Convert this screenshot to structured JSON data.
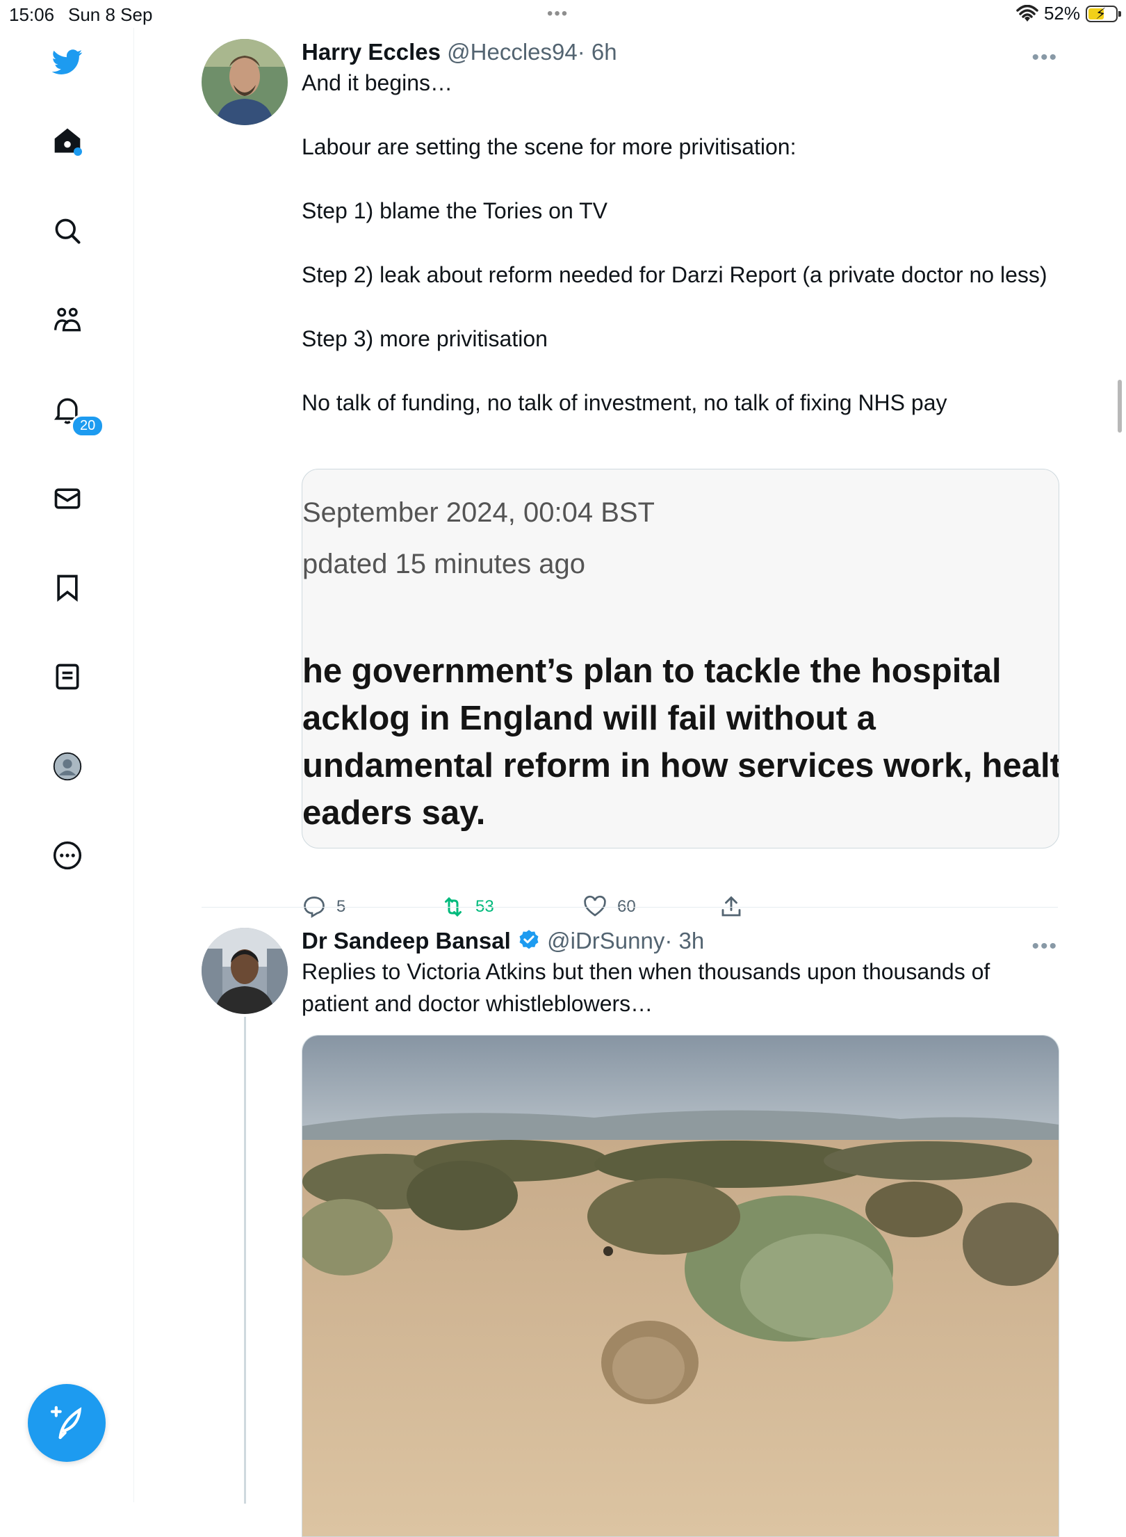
{
  "status_bar": {
    "time": "15:06",
    "date": "Sun 8 Sep",
    "battery": "52%"
  },
  "sidebar": {
    "items": [
      {
        "icon": "twitter-bird-icon"
      },
      {
        "icon": "home-icon"
      },
      {
        "icon": "search-icon"
      },
      {
        "icon": "communities-icon"
      },
      {
        "icon": "notifications-icon",
        "badge": "20"
      },
      {
        "icon": "messages-icon"
      },
      {
        "icon": "bookmark-icon"
      },
      {
        "icon": "lists-icon"
      },
      {
        "icon": "profile-icon"
      },
      {
        "icon": "more-icon"
      }
    ],
    "compose_icon": "compose-icon"
  },
  "tweets": [
    {
      "name": "Harry Eccles",
      "handle": "@Heccles94",
      "time": "· 6h",
      "text": [
        "And it begins…",
        "Labour are setting the scene for more privitisation:",
        "Step 1) blame the Tories on TV",
        "Step 2) leak about reform needed for Darzi Report (a private doctor no less)",
        "Step 3) more privitisation",
        "No talk of funding, no talk of investment, no talk of fixing NHS pay"
      ],
      "card": {
        "line1": "September 2024, 00:04 BST",
        "line2": "pdated 15 minutes ago",
        "headline": [
          "he government’s plan to tackle the hospital",
          "acklog in England will fail without a",
          "undamental reform in how services work, health",
          "eaders say."
        ]
      },
      "actions": {
        "replies": "5",
        "retweets": "53",
        "likes": "60"
      },
      "colors": {
        "retweet": "#00ba7c"
      }
    },
    {
      "name": "Dr Sandeep Bansal",
      "handle": "@iDrSunny",
      "time": "· 3h",
      "verified": true,
      "text": [
        "Replies to Victoria Atkins but then when thousands upon thousands of patient and doctor whistleblowers…"
      ]
    }
  ]
}
